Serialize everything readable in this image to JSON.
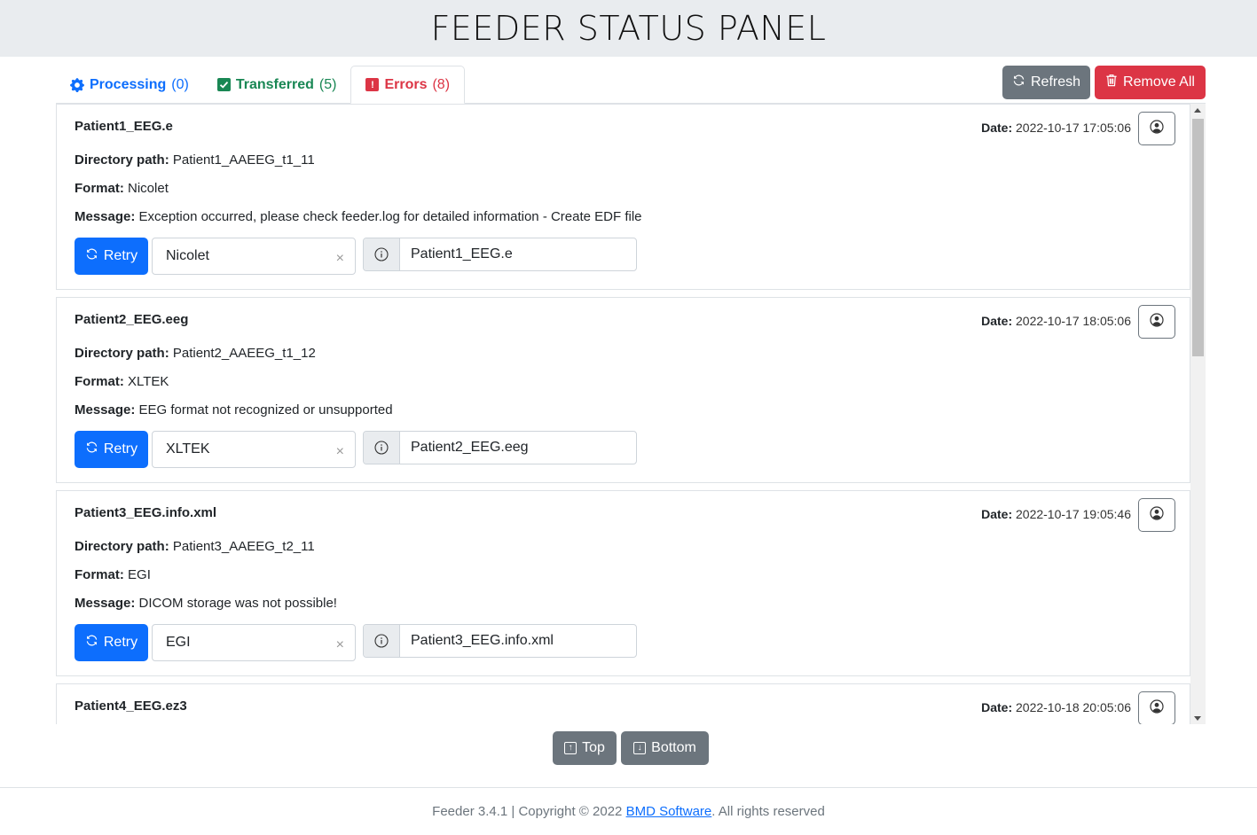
{
  "header": {
    "title": "FEEDER STATUS PANEL"
  },
  "tabs": [
    {
      "label": "Processing",
      "count": "(0)",
      "icon": "gear-icon",
      "color": "#0d6efd"
    },
    {
      "label": "Transferred",
      "count": "(5)",
      "icon": "check-square-icon",
      "color": "#198754"
    },
    {
      "label": "Errors",
      "count": "(8)",
      "icon": "exclamation-square-icon",
      "color": "#dc3545",
      "active": true
    }
  ],
  "toolbar": {
    "refresh_label": "Refresh",
    "remove_all_label": "Remove All"
  },
  "labels": {
    "date": "Date:",
    "directory": "Directory path:",
    "format": "Format:",
    "message": "Message:",
    "retry": "Retry",
    "clear": "×"
  },
  "errors": [
    {
      "file": "Patient1_EEG.e",
      "date": "2022-10-17 17:05:06",
      "directory": "Patient1_AAEEG_t1_11",
      "format": "Nicolet",
      "message": "Exception occurred, please check feeder.log for detailed information - Create EDF file",
      "selected_format": "Nicolet",
      "info_value": "Patient1_EEG.e"
    },
    {
      "file": "Patient2_EEG.eeg",
      "date": "2022-10-17 18:05:06",
      "directory": "Patient2_AAEEG_t1_12",
      "format": "XLTEK",
      "message": "EEG format not recognized or unsupported",
      "selected_format": "XLTEK",
      "info_value": "Patient2_EEG.eeg"
    },
    {
      "file": "Patient3_EEG.info.xml",
      "date": "2022-10-17 19:05:46",
      "directory": "Patient3_AAEEG_t2_11",
      "format": "EGI",
      "message": "DICOM storage was not possible!",
      "selected_format": "EGI",
      "info_value": "Patient3_EEG.info.xml"
    },
    {
      "file": "Patient4_EEG.ez3",
      "date": "2022-10-18 20:05:06"
    }
  ],
  "nav": {
    "top_label": "Top",
    "bottom_label": "Bottom"
  },
  "footer": {
    "prefix": "Feeder 3.4.1 | Copyright © 2022 ",
    "link": "BMD Software",
    "suffix": ". All rights reserved"
  },
  "colors": {
    "primary": "#0d6efd",
    "success": "#198754",
    "danger": "#dc3545",
    "secondary": "#6c757d",
    "header_bg": "#e9ecef"
  }
}
